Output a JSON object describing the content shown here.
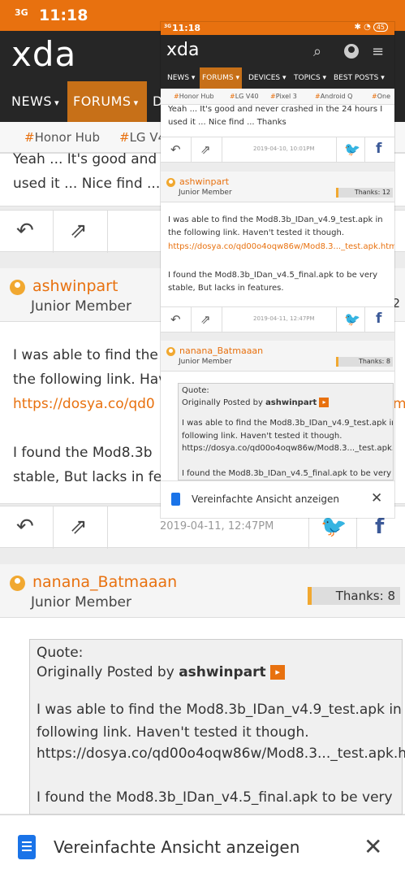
{
  "status_bar": {
    "signal": "3G",
    "time": "11:18",
    "battery": "45"
  },
  "site": {
    "logo": "xda"
  },
  "nav": {
    "items": [
      "NEWS",
      "FORUMS",
      "DEVICES",
      "TOPICS",
      "BEST POSTS"
    ],
    "active": "FORUMS",
    "bg_partial": "D"
  },
  "tags": {
    "items": [
      "Honor Hub",
      "LG V40",
      "Pixel 3",
      "Android Q",
      "One"
    ],
    "bg_second_partial": "LG V4"
  },
  "post1": {
    "text_line1": "Yeah ... It's good and never crashed in the 24 hours I",
    "text_line2": "used it ... Nice find ... Thanks",
    "bg_line1": "Yeah ... It's good and n",
    "bg_line2": "used it ... Nice find ... Th",
    "date": "2019-04-10, 10:01PM"
  },
  "post2": {
    "username": "ashwinpart",
    "rank": "Junior Member",
    "thanks": "Thanks: 12",
    "bg_thanks_partial": "2",
    "line1": "I was able to find the Mod8.3b_IDan_v4.9_test.apk in",
    "line2": "the following link. Haven't tested it though.",
    "link": "https://dosya.co/qd00o4oqw86w/Mod8.3..._test.apk.htm",
    "line3": "I found the Mod8.3b_IDan_v4.5_final.apk to be very",
    "line4": "stable, But lacks in features.",
    "bg_line1": "I was able to find the",
    "bg_line2": "the following link. Hav",
    "bg_link": "https://dosya.co/qd0",
    "bg_link_end": "m",
    "bg_line3": "I found the Mod8.3b",
    "bg_line4": "stable, But lacks in fea",
    "date": "2019-04-11, 12:47PM"
  },
  "post3": {
    "username": "nanana_Batmaaan",
    "rank": "Junior Member",
    "thanks": "Thanks: 8",
    "quote_label": "Quote:",
    "quote_origin_prefix": "Originally Posted by",
    "quote_author": "ashwinpart",
    "q_line1": "I was able to find the Mod8.3b_IDan_v4.9_test.apk in",
    "q_line2": "following link. Haven't tested it though.",
    "q_line3": "https://dosya.co/qd00o4oqw86w/Mod8.3..._test.apk.h",
    "q_line4": "I found the Mod8.3b_IDan_v4.5_final.apk to be very"
  },
  "bottom_bar": {
    "label": "Vereinfachte Ansicht anzeigen"
  },
  "colors": {
    "brand_orange": "#e8710f",
    "header_dark": "#262626",
    "twitter": "#1da1f2",
    "facebook": "#3b5998"
  },
  "icons": {
    "reply": "reply-icon",
    "share": "share-icon",
    "twitter": "twitter-icon",
    "facebook": "facebook-icon",
    "search": "search-icon",
    "profile": "profile-icon",
    "menu": "menu-icon",
    "document": "document-icon",
    "close": "close-icon"
  }
}
